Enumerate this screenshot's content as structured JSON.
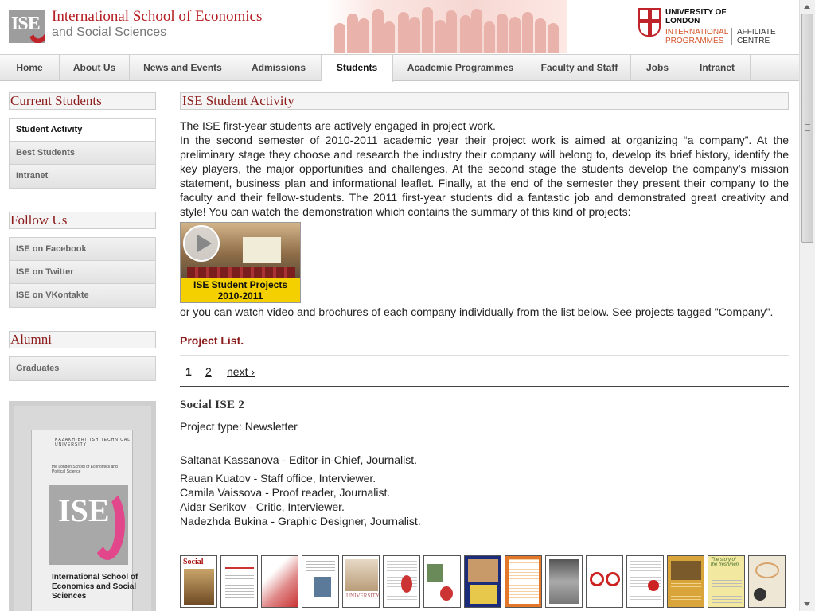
{
  "header": {
    "logo_text": "ISE",
    "title": "International School of Economics",
    "subtitle": "and Social Sciences",
    "affiliate_name": "UNIVERSITY OF LONDON",
    "affiliate_programmes": "INTERNATIONAL PROGRAMMES",
    "affiliate_centre": "AFFILIATE CENTRE"
  },
  "nav": {
    "items": [
      {
        "label": "Home"
      },
      {
        "label": "About Us"
      },
      {
        "label": "News and Events"
      },
      {
        "label": "Admissions"
      },
      {
        "label": "Students"
      },
      {
        "label": "Academic Programmes"
      },
      {
        "label": "Faculty and Staff"
      },
      {
        "label": "Jobs"
      },
      {
        "label": "Intranet"
      }
    ],
    "active": "Students"
  },
  "sidebar": {
    "current_students": {
      "title": "Current Students",
      "items": [
        {
          "label": "Student Activity"
        },
        {
          "label": "Best Students"
        },
        {
          "label": "Intranet"
        }
      ]
    },
    "follow_us": {
      "title": "Follow Us",
      "items": [
        {
          "label": "ISE on Facebook"
        },
        {
          "label": "ISE on Twitter"
        },
        {
          "label": "ISE on VKontakte"
        }
      ]
    },
    "alumni": {
      "title": "Alumni",
      "items": [
        {
          "label": "Graduates"
        }
      ]
    },
    "poster": {
      "header_text": "KAZAKH-BRITISH TECHNICAL UNIVERSITY",
      "small_text": "the London School of Economics and Political Science",
      "logo_text": "ISE",
      "caption": "International School of Economics and Social Sciences"
    }
  },
  "main": {
    "title": "ISE Student Activity",
    "intro_line1": "The ISE first-year students are actively engaged in project work.",
    "intro_line2": "In the second semester of 2010-2011 academic year their project work is aimed at organizing “a company”. At the preliminary stage they choose and research the industry their company will belong to, develop its brief history, identify the key players, the major opportunities and challenges. At the second stage the students develop the company’s mission statement, business plan and informational leaflet. Finally, at the end of the semester they present their company to the faculty and their fellow-students. The 2011 first-year students did a fantastic job and demonstrated great creativity and style! You can watch the demonstration which contains the summary of this kind of projects:",
    "video_label": "ISE Student Projects 2010-2011",
    "after_video": "or you can watch video and brochures of each company individually from the list below. See projects tagged \"Company\".",
    "project_list_title": "Project List.",
    "pager": {
      "page1": "1",
      "page2": "2",
      "next": "next ›"
    },
    "project": {
      "name": "Social ISE 2",
      "type": "Project type: Newsletter",
      "lead": "Saltanat Kassanova - Editor-in-Chief, Journalist.",
      "members": [
        "Rauan Kuatov - Staff office, Interviewer.",
        "Camila Vaissova - Proof reader, Journalist.",
        "Aidar Serikov - Critic, Interviewer.",
        "Nadezhda Bukina - Graphic Designer, Journalist."
      ]
    },
    "thumbnails": [
      {
        "caption": "Social"
      },
      {
        "caption": ""
      },
      {
        "caption": ""
      },
      {
        "caption": ""
      },
      {
        "caption": "UNIVERSITY"
      },
      {
        "caption": ""
      },
      {
        "caption": ""
      },
      {
        "caption": ""
      },
      {
        "caption": ""
      },
      {
        "caption": ""
      },
      {
        "caption": ""
      },
      {
        "caption": ""
      },
      {
        "caption": ""
      },
      {
        "caption": "The story of the freshmen"
      },
      {
        "caption": ""
      }
    ]
  }
}
